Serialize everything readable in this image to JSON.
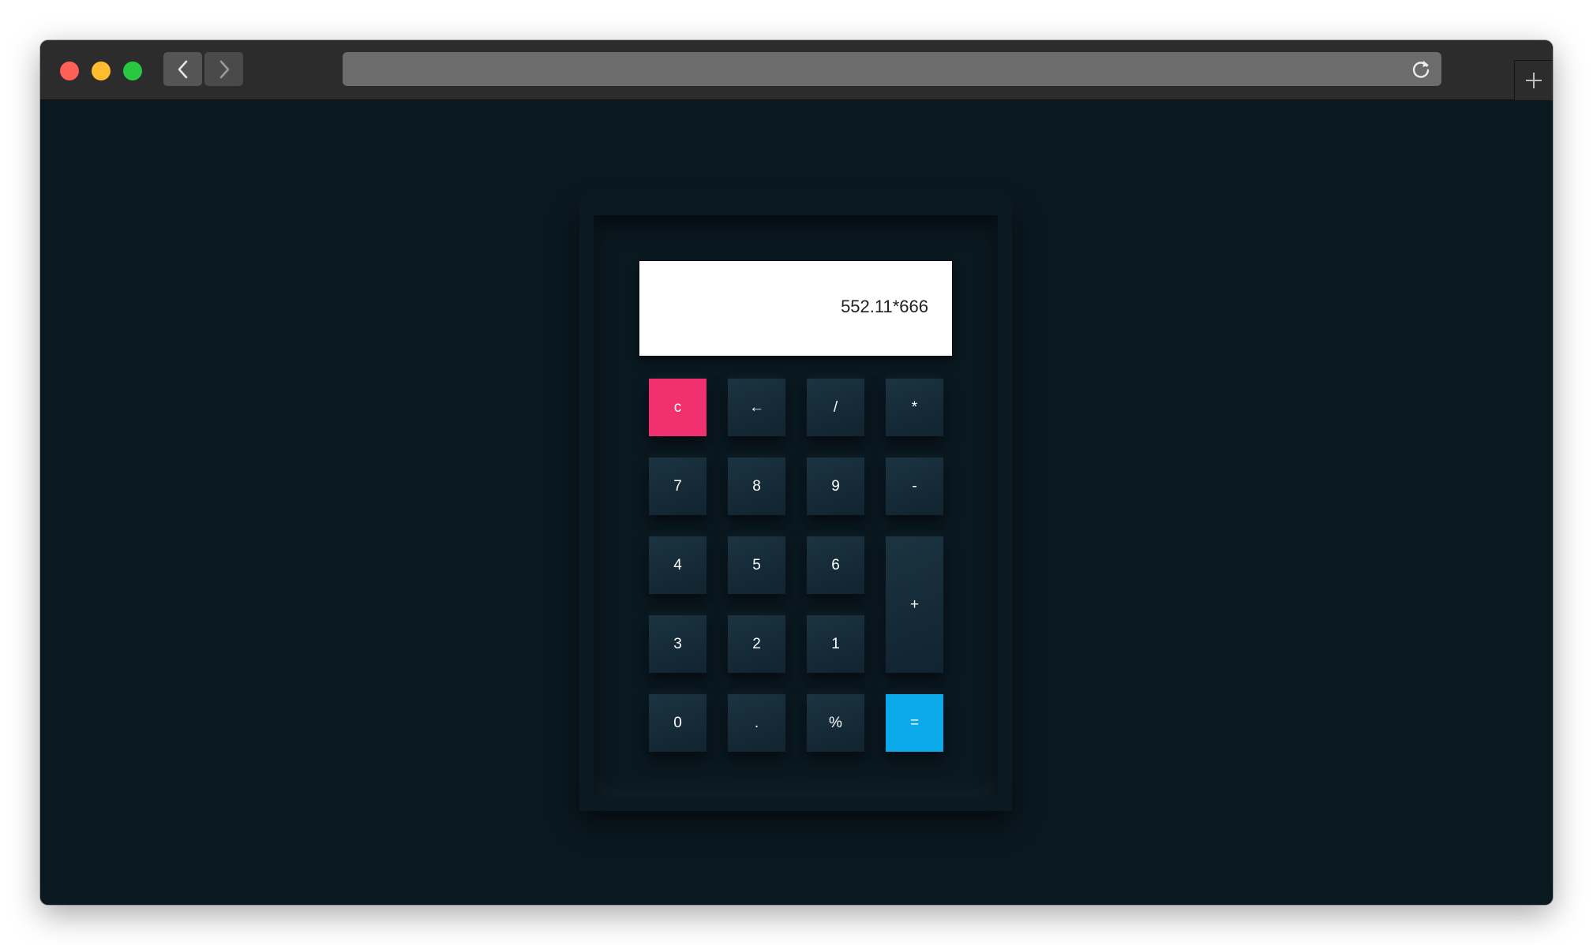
{
  "colors": {
    "page_bg": "#0a1820",
    "key_bg": "#142a36",
    "clear_key": "#f1306f",
    "equals_key": "#0aa9ea",
    "display_bg": "#ffffff"
  },
  "browser": {
    "back_icon": "chevron-left-icon",
    "forward_icon": "chevron-right-icon",
    "reload_icon": "reload-icon",
    "new_tab_icon": "plus-icon"
  },
  "calculator": {
    "display_value": "552.11*666",
    "keys": {
      "clear": "c",
      "backspace": "←",
      "divide": "/",
      "multiply": "*",
      "seven": "7",
      "eight": "8",
      "nine": "9",
      "minus": "-",
      "four": "4",
      "five": "5",
      "six": "6",
      "plus": "+",
      "three": "3",
      "two": "2",
      "one": "1",
      "zero": "0",
      "decimal": ".",
      "percent": "%",
      "equals": "="
    }
  }
}
